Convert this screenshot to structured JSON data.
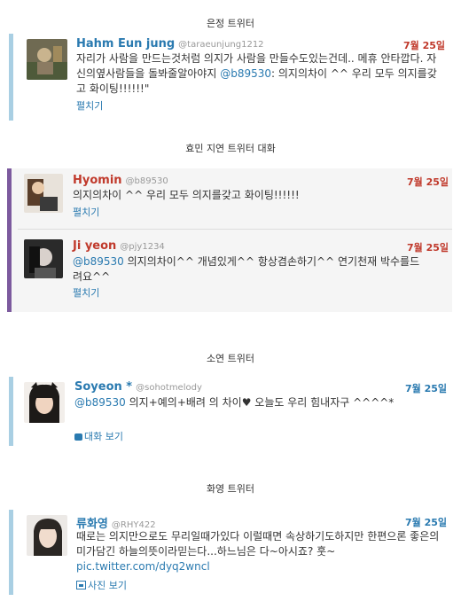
{
  "sections": [
    {
      "title": "은정 트위터"
    },
    {
      "title": "효민 지연 트위터 대화"
    },
    {
      "title": "소연 트위터"
    },
    {
      "title": "화영 트위터"
    }
  ],
  "tweets": [
    {
      "name": "Hahm Eun jung",
      "handle": "@taraeunjung1212",
      "date": "7월 25일",
      "text_before": "자리가 사람을 만드는것처럼 의지가 사람을 만들수도있는건데.. 메휴 안타깝다. 자신의옆사람들을 돌봐줄알아야지 ",
      "mention": "@b89530",
      "text_after": ": 의지의차이 ^^ 우리 모두 의지를갖고 화이팅!!!!!!\"",
      "action": "펼치기"
    },
    {
      "name": "Hyomin",
      "handle": "@b89530",
      "date": "7월 25일",
      "text": "의지의차이 ^^ 우리 모두 의지를갖고 화이팅!!!!!!",
      "action": "펼치기"
    },
    {
      "name": "Ji yeon",
      "handle": "@pjy1234",
      "date": "7월 25일",
      "mention": "@b89530",
      "text": " 의지의차이^^ 개념있게^^ 항상겸손하기^^ 연기천재 박수를드려요^^",
      "action": "펼치기"
    },
    {
      "name": "Soyeon *",
      "handle": "@sohotmelody",
      "date": "7월 25일",
      "mention": "@b89530",
      "text": " 의지+예의+배려 의 차이♥ 오늘도 우리 힘내자구 ^^^^*",
      "action": "대화 보기"
    },
    {
      "name": "류화영",
      "handle": "@RHY422",
      "date": "7월 25일",
      "text": "때로는 의지만으로도 무리일때가있다 이럴때면 속상하기도하지만 한편으론 좋은의미가담긴 하늘의뜻이라믿는다...하느님은 다~아시죠? 훗~ ",
      "link": "pic.twitter.com/dyq2wncl",
      "action": "사진 보기"
    }
  ],
  "colors": {
    "bar_blue": "#a9cfe3",
    "bar_purple": "#7c5a9e",
    "name_blue": "#2a7ab0",
    "name_red": "#c0392b",
    "date_red": "#c0392b",
    "date_blue": "#2a7ab0"
  }
}
